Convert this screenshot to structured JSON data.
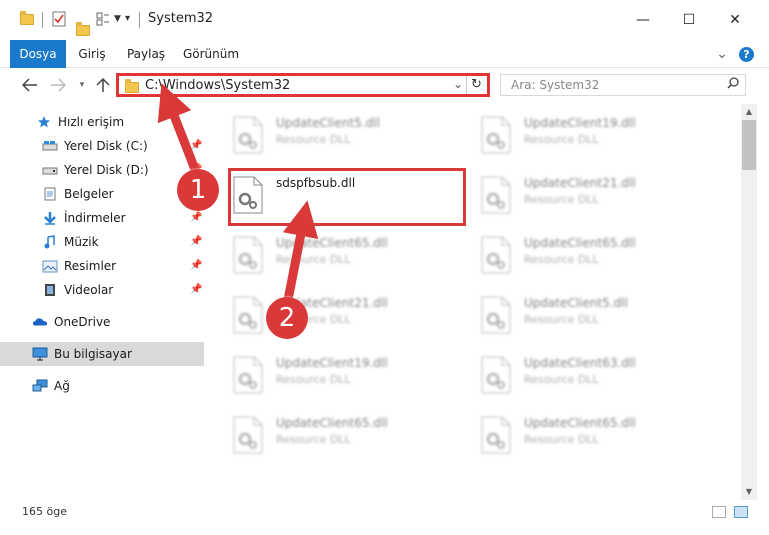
{
  "window": {
    "title": "System32",
    "minimize_glyph": "—",
    "maximize_glyph": "☐",
    "close_glyph": "✕"
  },
  "ribbon": {
    "tabs": [
      {
        "label": "Dosya"
      },
      {
        "label": "Giriş"
      },
      {
        "label": "Paylaş"
      },
      {
        "label": "Görünüm"
      }
    ],
    "collapse_glyph": "⌄",
    "help_glyph": "?"
  },
  "nav": {
    "address_path": "C:\\Windows\\System32",
    "search_placeholder": "Ara: System32"
  },
  "sidebar": {
    "items": [
      {
        "label": "Hızlı erişim",
        "icon": "star-icon",
        "pinned": false
      },
      {
        "label": "Yerel Disk (C:)",
        "icon": "drive-c-icon",
        "pinned": true
      },
      {
        "label": "Yerel Disk (D:)",
        "icon": "drive-d-icon",
        "pinned": true
      },
      {
        "label": "Belgeler",
        "icon": "documents-icon",
        "pinned": true
      },
      {
        "label": "İndirmeler",
        "icon": "downloads-icon",
        "pinned": true
      },
      {
        "label": "Müzik",
        "icon": "music-icon",
        "pinned": true
      },
      {
        "label": "Resimler",
        "icon": "pictures-icon",
        "pinned": true
      },
      {
        "label": "Videolar",
        "icon": "videos-icon",
        "pinned": true
      },
      {
        "label": "OneDrive",
        "icon": "onedrive-icon",
        "pinned": false
      },
      {
        "label": "Bu bilgisayar",
        "icon": "this-pc-icon",
        "pinned": false
      },
      {
        "label": "Ağ",
        "icon": "network-icon",
        "pinned": false
      }
    ]
  },
  "files": {
    "left_column": [
      {
        "name": "UpdateClient5.dll",
        "type": "Resource DLL"
      },
      {
        "name": "sdspfbsub.dll",
        "type": ""
      },
      {
        "name": "UpdateClient65.dll",
        "type": "Resource DLL"
      },
      {
        "name": "UpdateClient21.dll",
        "type": "Resource DLL"
      },
      {
        "name": "UpdateClient19.dll",
        "type": "Resource DLL"
      },
      {
        "name": "UpdateClient65.dll",
        "type": "Resource DLL"
      }
    ],
    "right_column": [
      {
        "name": "UpdateClient19.dll",
        "type": "Resource DLL"
      },
      {
        "name": "UpdateClient21.dll",
        "type": "Resource DLL"
      },
      {
        "name": "UpdateClient65.dll",
        "type": "Resource DLL"
      },
      {
        "name": "UpdateClient5.dll",
        "type": "Resource DLL"
      },
      {
        "name": "UpdateClient63.dll",
        "type": "Resource DLL"
      },
      {
        "name": "UpdateClient65.dll",
        "type": "Resource DLL"
      }
    ]
  },
  "status": {
    "item_count": "165 öge"
  },
  "annotations": {
    "step1": "1",
    "step2": "2",
    "color": "#d93939"
  },
  "colors": {
    "accent": "#1979ca",
    "highlight": "#d93939",
    "selected_nav": "#d9d9d9"
  }
}
